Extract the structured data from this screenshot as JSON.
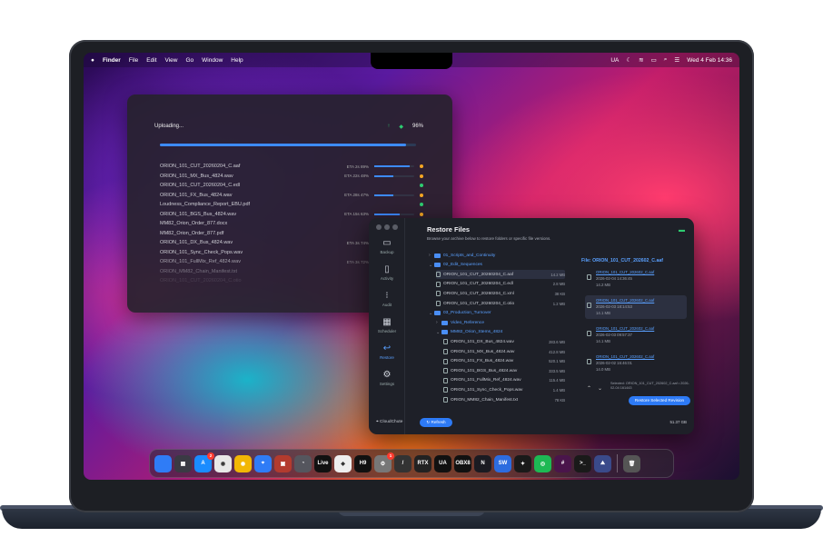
{
  "menubar": {
    "apple": "",
    "items": [
      "Finder",
      "File",
      "Edit",
      "View",
      "Go",
      "Window",
      "Help"
    ],
    "lang": "UA",
    "clock": "Wed 4 Feb  14:36"
  },
  "upload": {
    "status": "Uploading...",
    "percent": "96%",
    "overall_progress": 0.96,
    "files": [
      {
        "name": "ORION_101_CUT_20260204_C.aaf",
        "eta": "ETA 2s  89%",
        "progress": 0.89,
        "dot": "#f5a623"
      },
      {
        "name": "ORION_101_MX_Bus_4824.wav",
        "eta": "ETA 22s  48%",
        "progress": 0.48,
        "dot": "#f5a623"
      },
      {
        "name": "ORION_101_CUT_20260204_C.edl",
        "eta": "",
        "progress": 1,
        "dot": "#2ecc71"
      },
      {
        "name": "ORION_101_FX_Bus_4824.wav",
        "eta": "ETA 28s  47%",
        "progress": 0.47,
        "dot": "#f5a623"
      },
      {
        "name": "Loudness_Compliance_Report_EBU.pdf",
        "eta": "",
        "progress": 1,
        "dot": "#2ecc71"
      },
      {
        "name": "ORION_101_BGS_Bus_4824.wav",
        "eta": "ETA 15s  63%",
        "progress": 0.63,
        "dot": "#f5a623"
      },
      {
        "name": "MM82_Orion_Order_877.docx",
        "eta": "",
        "progress": 1,
        "dot": "#2ecc71"
      },
      {
        "name": "MM82_Orion_Order_877.pdf",
        "eta": "",
        "progress": 1,
        "dot": "#2ecc71"
      },
      {
        "name": "ORION_101_DX_Bus_4824.wav",
        "eta": "ETA 3s  74%",
        "progress": 0.74,
        "dot": "#f5a623"
      },
      {
        "name": "ORION_101_Sync_Check_Pops.wav",
        "eta": "",
        "progress": 1,
        "dot": "#2ecc71"
      },
      {
        "name": "ORION_101_FullMix_Ref_4824.wav",
        "eta": "ETA 3s  72%",
        "progress": 0.72,
        "dot": "#f5a623"
      },
      {
        "name": "ORION_MM82_Chain_Manifest.txt",
        "eta": "",
        "progress": 1,
        "dot": "#2ecc71"
      },
      {
        "name": "ORION_101_CUT_20260204_C.otio",
        "eta": "",
        "progress": 1,
        "dot": "#2ecc71"
      }
    ]
  },
  "restore": {
    "title": "Restore Files",
    "subtitle": "Browse your archive below to restore folders or specific file versions.",
    "sidebar": [
      {
        "label": "Backup",
        "icon": "drive-icon"
      },
      {
        "label": "Activity",
        "icon": "phone-icon"
      },
      {
        "label": "Audit",
        "icon": "audit-icon"
      },
      {
        "label": "Scheduler",
        "icon": "calendar-icon"
      },
      {
        "label": "Restore",
        "icon": "restore-icon"
      },
      {
        "label": "Settings",
        "icon": "gear-icon"
      }
    ],
    "tree": [
      {
        "label": "01_Scripts_and_Continuity",
        "type": "folder",
        "indent": 0,
        "chev": "›"
      },
      {
        "label": "02_Edit_Sequences",
        "type": "folder",
        "indent": 0,
        "chev": "⌄"
      },
      {
        "label": "ORION_101_CUT_20260204_C.aaf",
        "type": "file",
        "indent": 1,
        "size": "14.2 MB",
        "sel": true
      },
      {
        "label": "ORION_101_CUT_20260204_C.edl",
        "type": "file",
        "indent": 1,
        "size": "2.8 MB"
      },
      {
        "label": "ORION_101_CUT_20260204_C.xml",
        "type": "file",
        "indent": 1,
        "size": "38 KB"
      },
      {
        "label": "ORION_101_CUT_20260204_C.otio",
        "type": "file",
        "indent": 1,
        "size": "1.2 MB"
      },
      {
        "label": "03_Production_Turnover",
        "type": "folder",
        "indent": 0,
        "chev": "⌄"
      },
      {
        "label": "Video_Reference",
        "type": "folder",
        "indent": 1,
        "chev": "›"
      },
      {
        "label": "MM82_Orion_Stems_4824",
        "type": "folder",
        "indent": 1,
        "chev": "⌄"
      },
      {
        "label": "ORION_101_DX_Bus_4824.wav",
        "type": "file",
        "indent": 2,
        "size": "283.6 MB"
      },
      {
        "label": "ORION_101_MX_Bus_4824.wav",
        "type": "file",
        "indent": 2,
        "size": "412.8 MB"
      },
      {
        "label": "ORION_101_FX_Bus_4824.wav",
        "type": "file",
        "indent": 2,
        "size": "520.1 MB"
      },
      {
        "label": "ORION_101_BGS_Bus_4824.wav",
        "type": "file",
        "indent": 2,
        "size": "333.5 MB"
      },
      {
        "label": "ORION_101_FullMix_Ref_4824.wav",
        "type": "file",
        "indent": 2,
        "size": "115.4 MB"
      },
      {
        "label": "ORION_101_Sync_Check_Pops.wav",
        "type": "file",
        "indent": 2,
        "size": "1.4 MB"
      },
      {
        "label": "ORION_MM82_Chain_Manifest.txt",
        "type": "file",
        "indent": 2,
        "size": "78 KB"
      }
    ],
    "revisions_title": "File: ORION_101_CUT_202602_C.aaf",
    "revisions": [
      {
        "name": "ORION_101_CUT_202602_C.aaf",
        "date": "2026-02-04 14:36:45",
        "size": "14.2 MB",
        "sel": false
      },
      {
        "name": "ORION_101_CUT_202602_C.aaf",
        "date": "2026-02-03 18:14:53",
        "size": "14.1 MB",
        "sel": true
      },
      {
        "name": "ORION_101_CUT_202602_C.aaf",
        "date": "2026-02-03 09:57:37",
        "size": "14.1 MB",
        "sel": false
      },
      {
        "name": "ORION_101_CUT_202602_C.aaf",
        "date": "2026-02-02 16:46:01",
        "size": "14.0 MB",
        "sel": false
      }
    ],
    "selected_info": "Selected: ORION_101_CUT_202602_C.aaf • 2026-02-04 161443",
    "restore_button": "Restore Selected Revision",
    "refresh_button": "Refresh",
    "brand": "CloudChute",
    "disk": "51.37 GB"
  },
  "dock": {
    "apps": [
      {
        "name": "finder",
        "label": "",
        "color": "#2f7cf6",
        "badge": ""
      },
      {
        "name": "launchpad",
        "label": "▦",
        "color": "#3a3a44",
        "badge": ""
      },
      {
        "name": "app-store",
        "label": "A",
        "color": "#1a8cff",
        "badge": "2"
      },
      {
        "name": "chrome",
        "label": "◉",
        "color": "#e8e8e8",
        "badge": ""
      },
      {
        "name": "chrome-canary",
        "label": "◉",
        "color": "#f2b705",
        "badge": ""
      },
      {
        "name": "safari",
        "label": "⌖",
        "color": "#2f7cf6",
        "badge": ""
      },
      {
        "name": "media-app",
        "label": "▣",
        "color": "#b33b2e",
        "badge": ""
      },
      {
        "name": "compressor",
        "label": "◔",
        "color": "#55565e",
        "badge": ""
      },
      {
        "name": "ableton-live",
        "label": "Live",
        "color": "#111",
        "badge": ""
      },
      {
        "name": "pixel-app",
        "label": "◆",
        "color": "#eee",
        "badge": ""
      },
      {
        "name": "h9",
        "label": "H9",
        "color": "#111",
        "badge": ""
      },
      {
        "name": "settings",
        "label": "⚙",
        "color": "#777",
        "badge": "1"
      },
      {
        "name": "pencil-app",
        "label": "/",
        "color": "#333",
        "badge": ""
      },
      {
        "name": "rtx",
        "label": "RTX",
        "color": "#222",
        "badge": ""
      },
      {
        "name": "ua-connect",
        "label": "UA",
        "color": "#111",
        "badge": ""
      },
      {
        "name": "obs",
        "label": "OBX8",
        "color": "#111",
        "badge": ""
      },
      {
        "name": "native",
        "label": "N",
        "color": "#1b1b22",
        "badge": ""
      },
      {
        "name": "sw",
        "label": "SW",
        "color": "#2d6cdf",
        "badge": ""
      },
      {
        "name": "figma",
        "label": "✦",
        "color": "#1a1a1a",
        "badge": ""
      },
      {
        "name": "spotify",
        "label": "◎",
        "color": "#1db954",
        "badge": ""
      },
      {
        "name": "slack",
        "label": "#",
        "color": "#4a154b",
        "badge": ""
      },
      {
        "name": "terminal",
        "label": ">_",
        "color": "#1a1a1a",
        "badge": ""
      },
      {
        "name": "cloudchute",
        "label": "⛰",
        "color": "#3a4a8a",
        "badge": ""
      },
      {
        "name": "trash",
        "label": "🗑",
        "color": "#555",
        "badge": ""
      }
    ]
  }
}
